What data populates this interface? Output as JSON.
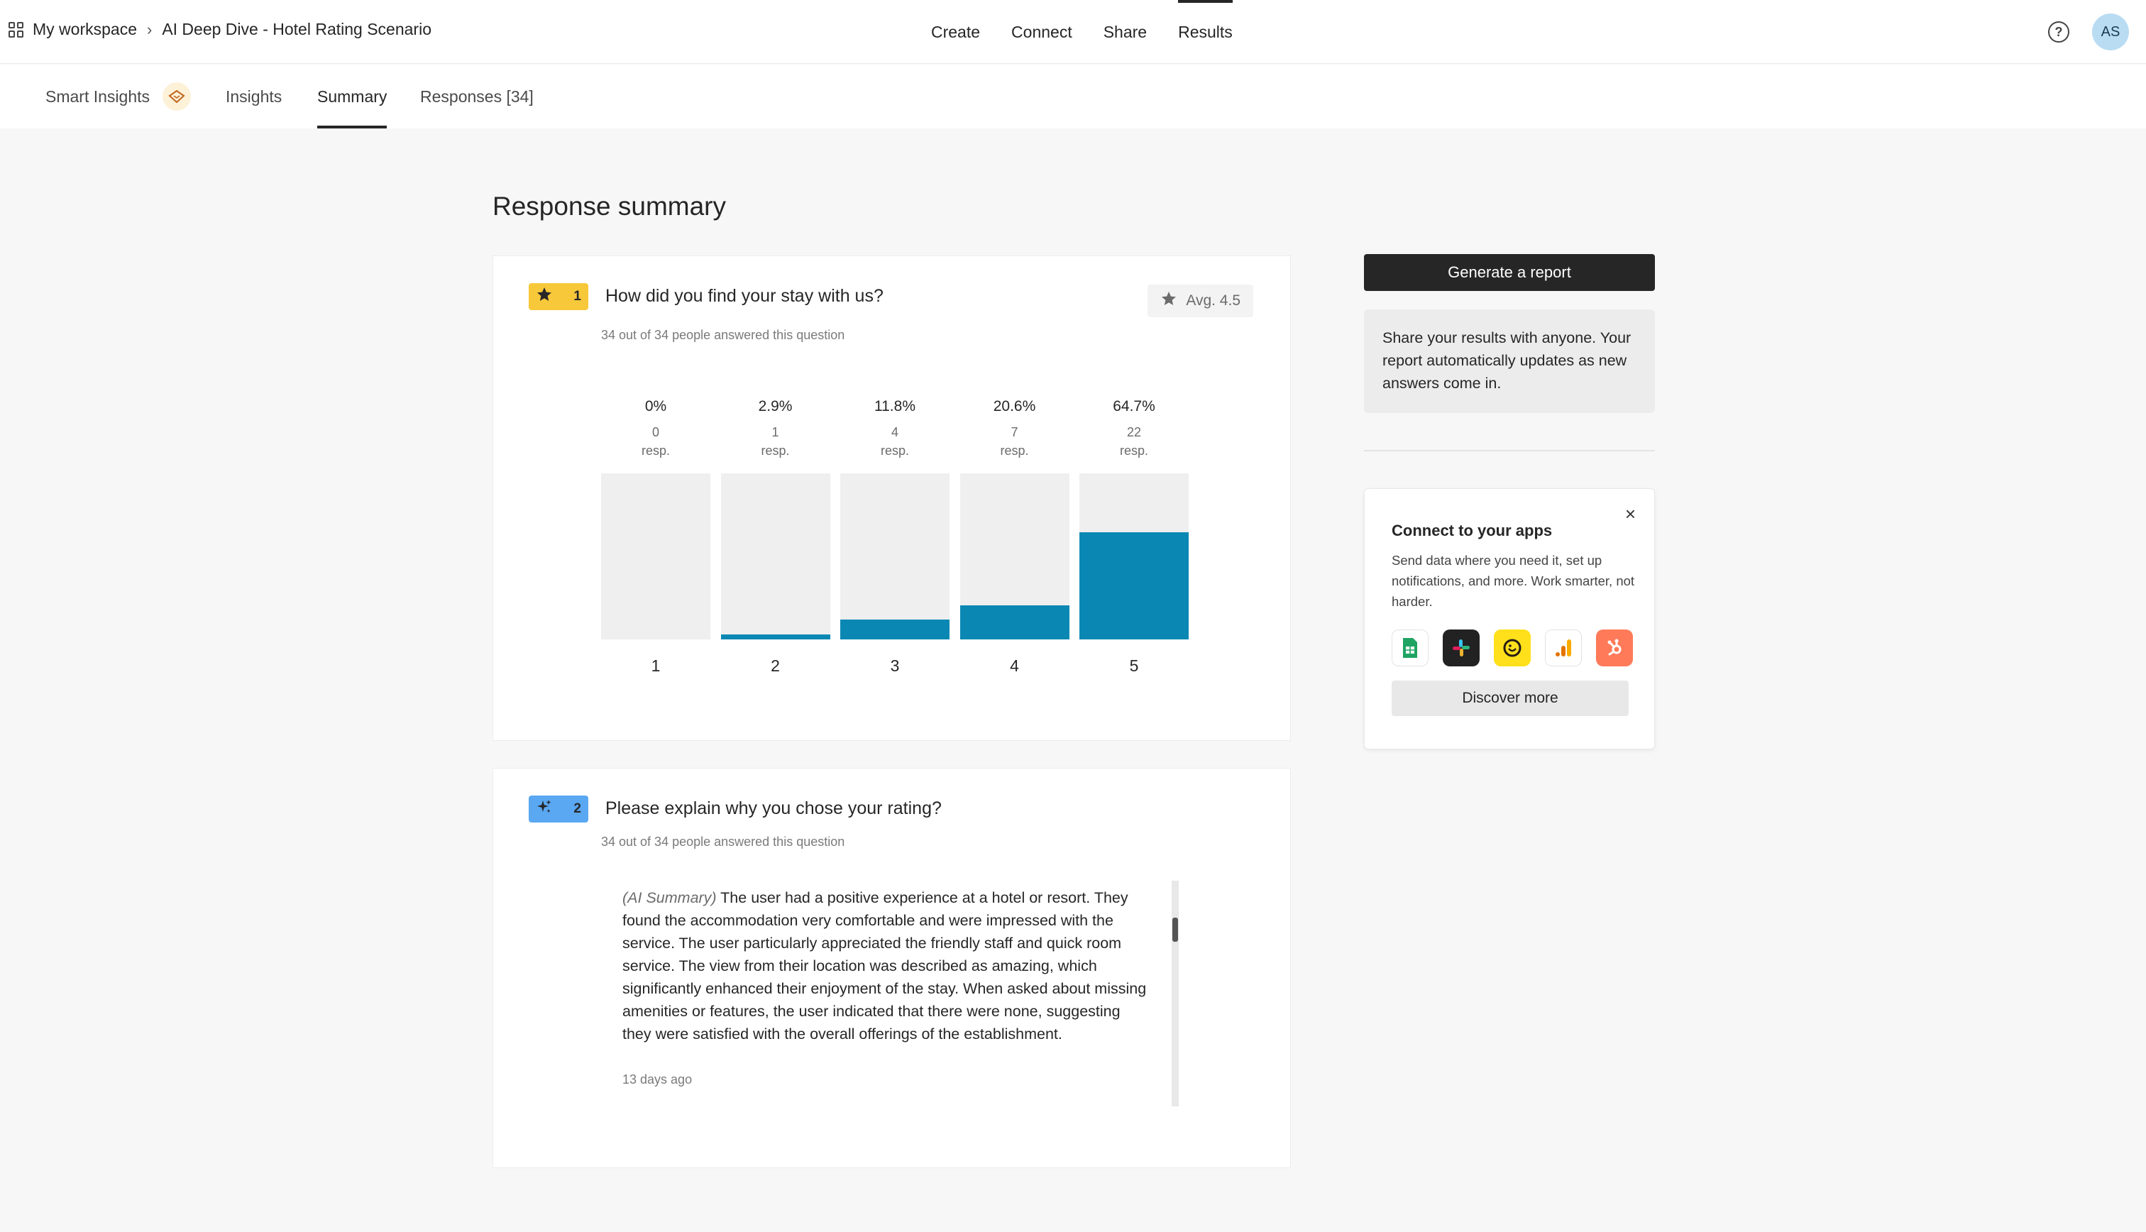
{
  "header": {
    "workspace": "My workspace",
    "form_title": "AI Deep Dive - Hotel Rating Scenario",
    "nav": [
      "Create",
      "Connect",
      "Share",
      "Results"
    ],
    "active_nav": "Results",
    "avatar_initials": "AS",
    "help_symbol": "?"
  },
  "subtabs": {
    "smart_insights": "Smart Insights",
    "insights": "Insights",
    "summary": "Summary",
    "responses": "Responses [34]",
    "active": "Summary"
  },
  "page_title": "Response summary",
  "questions": [
    {
      "number": "1",
      "icon": "star-icon",
      "title": "How did you find your stay with us?",
      "answered": "34 out of 34 people answered this question",
      "avg": "Avg. 4.5",
      "resp_unit": "resp."
    },
    {
      "number": "2",
      "icon": "sparkle-icon",
      "title": "Please explain why you chose your rating?",
      "answered": "34 out of 34 people answered this question",
      "summary_prefix": "(AI Summary)",
      "summary_text": " The user had a positive experience at a hotel or resort. They found the accommodation very comfortable and were impressed with the service. The user particularly appreciated the friendly staff and quick room service. The view from their location was described as amazing, which significantly enhanced their enjoyment of the stay. When asked about missing amenities or features, the user indicated that there were none, suggesting they were satisfied with the overall offerings of the establishment.",
      "time": "13 days ago"
    }
  ],
  "chart_data": {
    "type": "bar",
    "categories": [
      "1",
      "2",
      "3",
      "4",
      "5"
    ],
    "values": [
      0,
      2.9,
      11.8,
      20.6,
      64.7
    ],
    "value_labels": [
      "0%",
      "2.9%",
      "11.8%",
      "20.6%",
      "64.7%"
    ],
    "counts": [
      "0",
      "1",
      "4",
      "7",
      "22"
    ],
    "ylim": [
      0,
      100
    ],
    "color": "#0a88b3"
  },
  "sidebar": {
    "generate_report": "Generate a report",
    "share_text": "Share your results with anyone. Your report automatically updates as new answers come in.",
    "connect_title": "Connect to your apps",
    "connect_desc": "Send data where you need it, set up notifications, and more. Work smarter, not harder.",
    "apps": [
      "google-sheets-icon",
      "slack-icon",
      "mailchimp-icon",
      "google-analytics-icon",
      "hubspot-icon"
    ],
    "discover": "Discover more",
    "close_symbol": "×"
  },
  "colors": {
    "accent": "#0a88b3",
    "badge_yellow": "#f7c83a",
    "badge_blue": "#5aa7f2",
    "dark": "#262627"
  }
}
